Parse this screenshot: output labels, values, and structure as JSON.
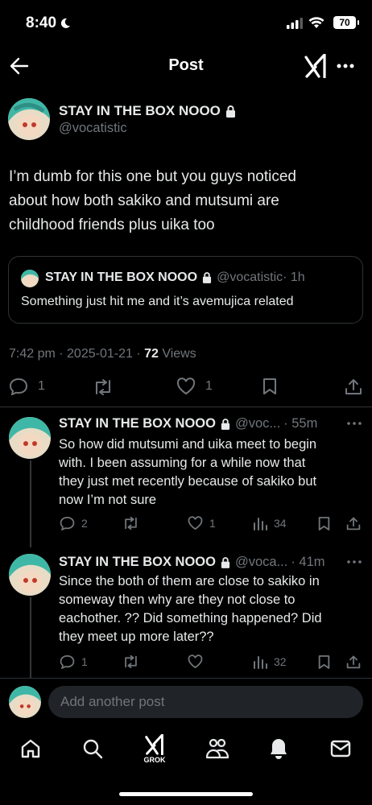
{
  "status_bar": {
    "time": "8:40",
    "battery": "70"
  },
  "header": {
    "title": "Post"
  },
  "main_post": {
    "display_name": "STAY IN THE BOX NOOO",
    "handle": "@vocatistic",
    "text_lines": [
      "I’m dumb for this one but you guys noticed",
      "about how both sakiko and mutsumi are",
      "childhood friends plus uika too"
    ],
    "quote": {
      "display_name": "STAY IN THE BOX NOOO",
      "handle": "@vocatistic",
      "time": "· 1h",
      "text": "Something just hit me and it’s avemujica related"
    },
    "timestamp": "7:42 pm · 2025-01-21 · ",
    "views_count": "72",
    "views_label": " Views",
    "replies": "1",
    "likes": "1"
  },
  "replies": [
    {
      "display_name": "STAY IN THE BOX NOOO",
      "handle": "@voc...",
      "time": "· 55m",
      "text_lines": [
        "So how did mutsumi and uika meet to begin",
        "with. I been assuming for a while now that",
        "they just met recently because of sakiko but",
        "now I’m not sure"
      ],
      "replies": "2",
      "likes": "1",
      "views": "34"
    },
    {
      "display_name": "STAY IN THE BOX NOOO",
      "handle": "@voca...",
      "time": "· 41m",
      "text_lines": [
        "Since the both of them are close to sakiko in",
        "someway then why are they not close to",
        "eachother. ?? Did something happened? Did",
        "they meet up more later??"
      ],
      "replies": "1",
      "likes": "",
      "views": "32"
    }
  ],
  "composer": {
    "placeholder": "Add another post"
  },
  "tab_bar": {
    "grok_label": "GROK"
  },
  "icons": {
    "back": "arrow-left-icon",
    "grok": "grok-icon",
    "more": "more-icon",
    "lock": "lock-icon",
    "reply": "reply-icon",
    "repost": "repost-icon",
    "like": "heart-icon",
    "bookmark": "bookmark-icon",
    "share": "share-icon",
    "views": "bar-chart-icon",
    "home": "home-icon",
    "search": "search-icon",
    "communities": "communities-icon",
    "notifications": "bell-icon",
    "messages": "mail-icon"
  },
  "colors": {
    "background": "#000000",
    "text": "#e7e9ea",
    "muted": "#71767b",
    "border": "#2f3336"
  }
}
